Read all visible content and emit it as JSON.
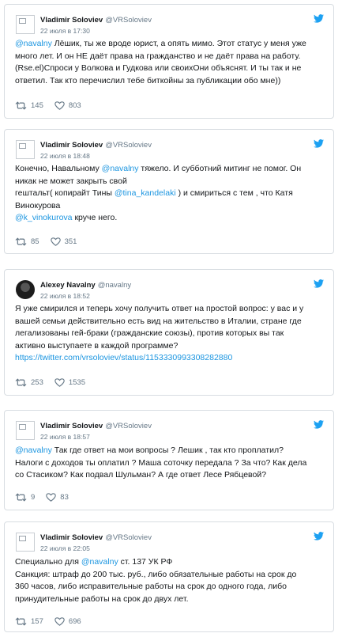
{
  "tweets": [
    {
      "name": "Vladimir Soloviev",
      "handle": "@VRSoloviev",
      "date": "22 июля в 17:30",
      "text_parts": [
        "@navalny",
        " Лёшик, ты же вроде юрист, а опять мимо. Этот статус у меня уже\nмного лет. И он НЕ даёт права на гражданство и не даёт права на работу.\n(Rse.el)Спроси у Волкова и Гудкова или своихОни объяснят. И ты так и не\nответил. Так кто перечислил тебе биткойны за публикации обо мне))"
      ],
      "retweets": "145",
      "likes": "803"
    },
    {
      "name": "Vladimir Soloviev",
      "handle": "@VRSoloviev",
      "date": "22 июля в 18:48",
      "text_parts": [
        "Конечно, Навальному ",
        "@navalny",
        " тяжело. И субботний митинг не помог. Он\nникак не может закрыть свой\nгештальт( копирайт Тины ",
        "@tina_kandelaki",
        " ) и смириться с тем , что Катя\nВинокурова\n",
        "@k_vinokurova",
        " круче него."
      ],
      "retweets": "85",
      "likes": "351"
    },
    {
      "name": "Alexey Navalny",
      "handle": "@navalny",
      "date": "22 июля в 18:52",
      "text_parts": [
        "Я уже смирился и теперь хочу получить ответ на простой вопрос: у вас и у\nвашей семьи действительно есть вид на жительство в Италии, стране где\nлегализованы гей-браки (гражданские союзы), против которых вы так\nактивно выступаете в каждой программе?\n",
        "https://twitter.com/vrsoloviev/status/1153330993308282880"
      ],
      "retweets": "253",
      "likes": "1535"
    },
    {
      "name": "Vladimir Soloviev",
      "handle": "@VRSoloviev",
      "date": "22 июля в 18:57",
      "text_parts": [
        "@navalny",
        " Так где ответ на мои вопросы ? Лешик , так кто проплатил?\nНалоги с доходов ты оплатил ? Маша соточку передала ? За что? Как дела\nсо Стасиком? Как подвал Шульман? А где ответ Лесе Рябцевой?"
      ],
      "retweets": "9",
      "likes": "83"
    },
    {
      "name": "Vladimir Soloviev",
      "handle": "@VRSoloviev",
      "date": "22 июля в 22:05",
      "text_parts": [
        "Специально для ",
        "@navalny",
        " ст. 137 УК РФ\nСанкция: штраф до 200 тыс. руб., либо обязательные работы на срок до\n360 часов, либо исправительные работы на срок до одного года, либо\nпринудительные работы на срок до двух лет."
      ],
      "retweets": "157",
      "likes": "696"
    }
  ],
  "colors": {
    "link": "#1b95e0",
    "bird": "#1da1f2",
    "muted": "#657786"
  }
}
